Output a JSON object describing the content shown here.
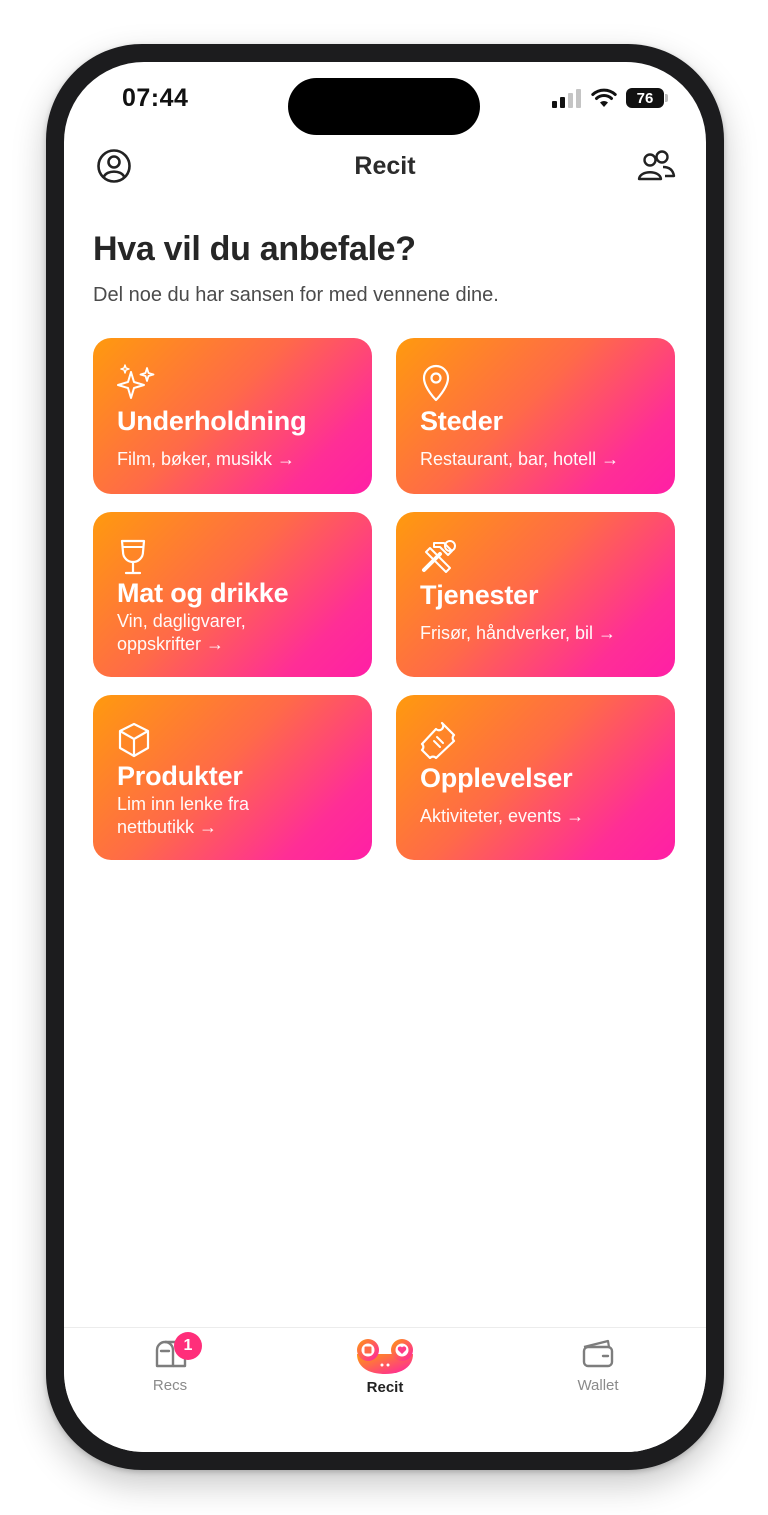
{
  "status_bar": {
    "time": "07:44",
    "battery": "76"
  },
  "nav": {
    "title": "Recit",
    "left_icon": "profile-icon",
    "right_icon": "friends-icon"
  },
  "heading": "Hva vil du anbefale?",
  "subheading": "Del noe du har sansen for med vennene dine.",
  "categories": [
    {
      "title": "Underholdning",
      "desc": "Film, bøker, musikk →",
      "icon": "sparkles-icon"
    },
    {
      "title": "Steder",
      "desc": "Restaurant, bar, hotell →",
      "icon": "map-pin-icon"
    },
    {
      "title": "Mat og drikke",
      "desc": "Vin, dagligvarer, oppskrifter →",
      "icon": "wine-glass-icon"
    },
    {
      "title": "Tjenester",
      "desc": "Frisør, håndverker, bil →",
      "icon": "tools-icon"
    },
    {
      "title": "Produkter",
      "desc": "Lim inn lenke fra nettbutikk →",
      "icon": "box-icon"
    },
    {
      "title": "Opplevelser",
      "desc": "Aktiviteter, events →",
      "icon": "ticket-icon"
    }
  ],
  "tabbar": {
    "items": [
      {
        "label": "Recs",
        "icon": "mailbox-icon",
        "badge": "1"
      },
      {
        "label": "Recit",
        "icon": "recit-logo-icon"
      },
      {
        "label": "Wallet",
        "icon": "wallet-icon"
      }
    ],
    "active": "Recit"
  },
  "colors": {
    "gradient_start": "#ff9a0e",
    "gradient_end": "#ff1fa6",
    "badge": "#ff2e7a"
  }
}
